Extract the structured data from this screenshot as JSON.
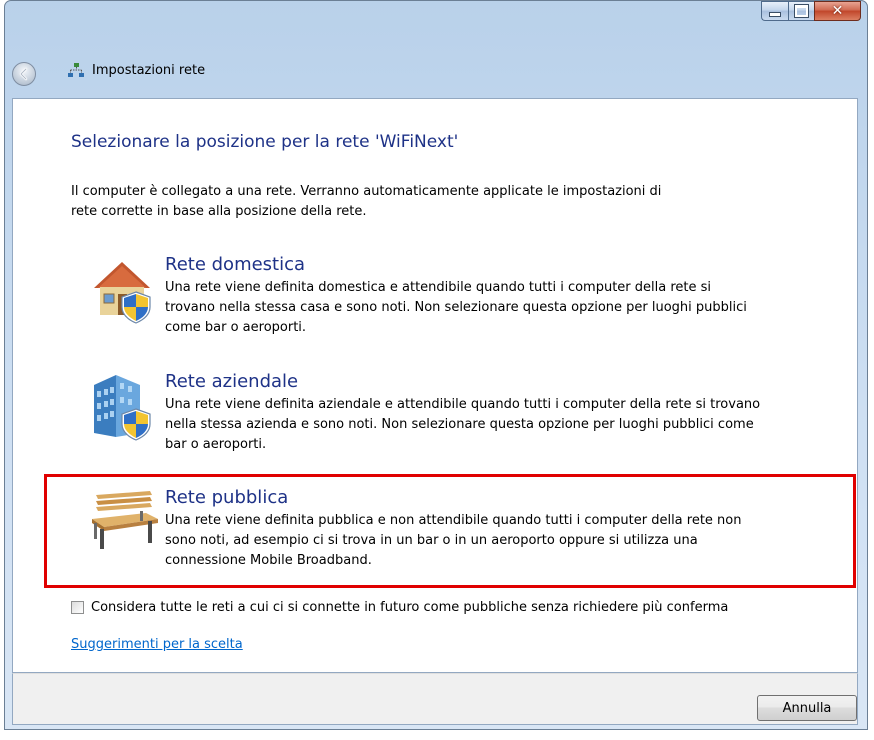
{
  "window": {
    "title": "Impostazioni rete"
  },
  "heading": "Selezionare la posizione per la rete 'WiFiNext'",
  "intro": "Il computer è collegato a una rete. Verranno automaticamente applicate le impostazioni di rete corrette in base alla posizione della rete.",
  "options": [
    {
      "title": "Rete domestica",
      "description": "Una rete viene definita domestica e attendibile quando tutti i computer della rete si trovano nella stessa casa e sono noti. Non selezionare questa opzione per luoghi pubblici come bar o aeroporti.",
      "icon": "house-shield-icon"
    },
    {
      "title": "Rete aziendale",
      "description": "Una rete viene definita aziendale e attendibile quando tutti i computer della rete si trovano nella stessa azienda e sono noti. Non selezionare questa opzione per luoghi pubblici come bar o aeroporti.",
      "icon": "office-building-shield-icon"
    },
    {
      "title": "Rete pubblica",
      "description": "Una rete viene definita pubblica e non attendibile quando tutti i computer della rete non sono noti, ad esempio ci si trova in un bar o in un aeroporto oppure si utilizza una connessione Mobile Broadband.",
      "icon": "park-bench-icon",
      "highlighted": true
    }
  ],
  "checkbox": {
    "label": "Considera tutte le reti a cui ci si connette in futuro come pubbliche senza richiedere più conferma",
    "checked": false
  },
  "link": "Suggerimenti per la scelta",
  "cancel_button": "Annulla",
  "colors": {
    "heading": "#1e3287",
    "link": "#0066cc",
    "highlight": "#e00000"
  }
}
